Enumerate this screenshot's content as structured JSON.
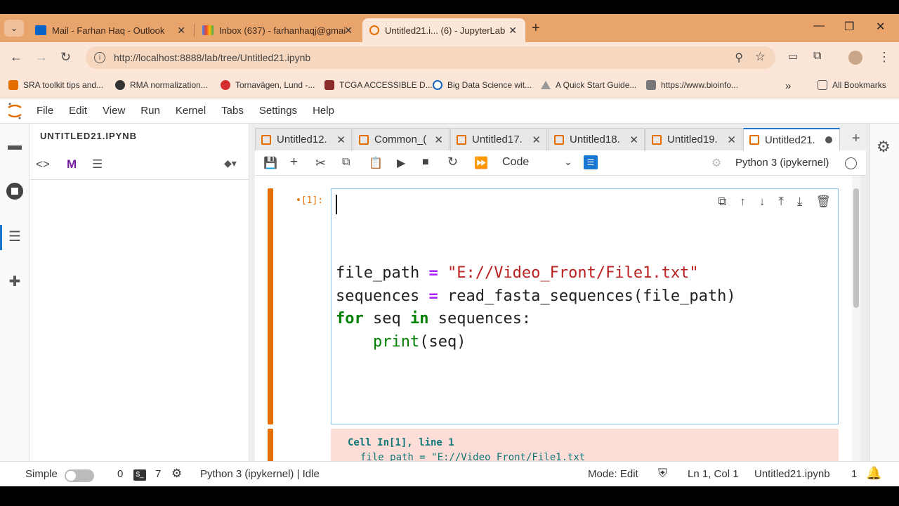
{
  "browser": {
    "tabs": [
      {
        "title": "Mail - Farhan Haq - Outlook",
        "icon": "outlook-icon"
      },
      {
        "title": "Inbox (637) - farhanhaqj@gmai",
        "icon": "gmail-icon"
      },
      {
        "title": "Untitled21.i... (6) - JupyterLab",
        "icon": "jupyter-icon",
        "active": true
      }
    ],
    "url": "http://localhost:8888/lab/tree/Untitled21.ipynb",
    "bookmarks": [
      "SRA toolkit tips and...",
      "RMA normalization...",
      "Tornavägen, Lund -...",
      "TCGA ACCESSIBLE D...",
      "Big Data Science wit...",
      "A Quick Start Guide...",
      "https://www.bioinfo..."
    ],
    "all_bookmarks": "All Bookmarks"
  },
  "jupyter": {
    "menu": [
      "File",
      "Edit",
      "View",
      "Run",
      "Kernel",
      "Tabs",
      "Settings",
      "Help"
    ],
    "file_panel_title": "UNTITLED21.IPYNB",
    "doc_tabs": [
      "Untitled12.",
      "Common_(",
      "Untitled17.",
      "Untitled18.",
      "Untitled19.",
      "Untitled21."
    ],
    "cell_type": "Code",
    "kernel_name": "Python 3 (ipykernel)",
    "cell_prompt": "•[1]:",
    "code": {
      "l1_var": "file_path",
      "l1_eq": " = ",
      "l1_str": "\"E://Video_Front/File1.txt\"",
      "l2_var": "sequences",
      "l2_eq": " = ",
      "l2_call": "read_fasta_sequences(file_path)",
      "l3_for": "for",
      "l3_seq": " seq ",
      "l3_in": "in",
      "l3_rest": " sequences:",
      "l4_indent": "    ",
      "l4_print": "print",
      "l4_rest": "(seq)"
    },
    "error": {
      "line1": "Cell In[1], line 1",
      "line2": "file_path = \"E://Video_Front/File1.txt"
    },
    "status": {
      "mode_label": "Simple",
      "count_a": "0",
      "count_b": "7",
      "kernel": "Python 3 (ipykernel) | Idle",
      "mode": "Mode: Edit",
      "position": "Ln 1, Col 1",
      "file": "Untitled21.ipynb",
      "notifications": "1"
    }
  },
  "colors": {
    "chrome": "#e9a46c",
    "accent": "#1976d2",
    "cell_orange": "#e46e00"
  }
}
